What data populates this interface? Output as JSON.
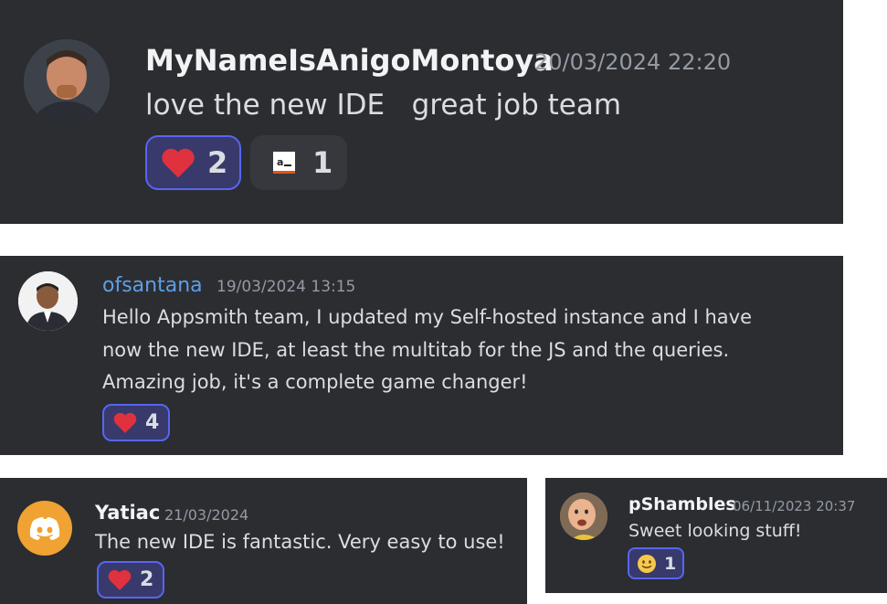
{
  "messages": [
    {
      "username": "MyNameIsAnigoMontoya",
      "timestamp": "20/03/2024 22:20",
      "text": "love the new IDE   great job team",
      "reactions": [
        {
          "icon": "heart-icon",
          "count": "2",
          "selected": true
        },
        {
          "icon": "appsmith-logo-icon",
          "count": "1",
          "selected": false
        }
      ]
    },
    {
      "username": "ofsantana",
      "username_color": "#5f9ee8",
      "timestamp": "19/03/2024 13:15",
      "lines": [
        "Hello Appsmith team, I updated my Self-hosted instance and I have",
        "now the new IDE, at least the multitab for the JS and the queries.",
        "Amazing job, it's a complete game changer!"
      ],
      "reactions": [
        {
          "icon": "heart-icon",
          "count": "4",
          "selected": true
        }
      ]
    },
    {
      "username": "Yatiac",
      "timestamp": "21/03/2024",
      "text": "The new IDE is fantastic. Very easy to use!",
      "reactions": [
        {
          "icon": "heart-icon",
          "count": "2",
          "selected": true
        }
      ]
    },
    {
      "username": "pShambles",
      "timestamp": "06/11/2023 20:37",
      "text": "Sweet looking stuff!",
      "reactions": [
        {
          "icon": "slightly-smiling-face-icon",
          "count": "1",
          "selected": true
        }
      ]
    }
  ],
  "colors": {
    "card_bg": "#2b2d31",
    "text": "#dbdee1",
    "muted": "#949ba4",
    "reaction_border": "#5865f2",
    "heart": "#e0313f",
    "discord_orange": "#f0a232"
  }
}
